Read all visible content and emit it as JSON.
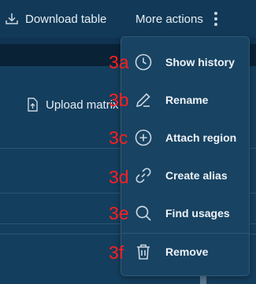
{
  "toolbar": {
    "download_label": "Download table",
    "more_actions_label": "More actions",
    "download_icon": "download-icon",
    "more_icon": "kebab-icon"
  },
  "content": {
    "upload_label": "Upload matrix",
    "upload_icon": "file-upload-icon"
  },
  "menu": {
    "items": [
      {
        "label": "Show history",
        "icon": "clock-icon",
        "annotation": "3a"
      },
      {
        "label": "Rename",
        "icon": "pencil-icon",
        "annotation": "3b"
      },
      {
        "label": "Attach region",
        "icon": "plus-circle-icon",
        "annotation": "3c"
      },
      {
        "label": "Create alias",
        "icon": "link-icon",
        "annotation": "3d"
      },
      {
        "label": "Find usages",
        "icon": "search-icon",
        "annotation": "3e"
      },
      {
        "label": "Remove",
        "icon": "trash-icon",
        "annotation": "3f"
      }
    ]
  },
  "colors": {
    "background": "#0f3350",
    "menu_background": "#184362",
    "annotation": "#ff2020"
  }
}
